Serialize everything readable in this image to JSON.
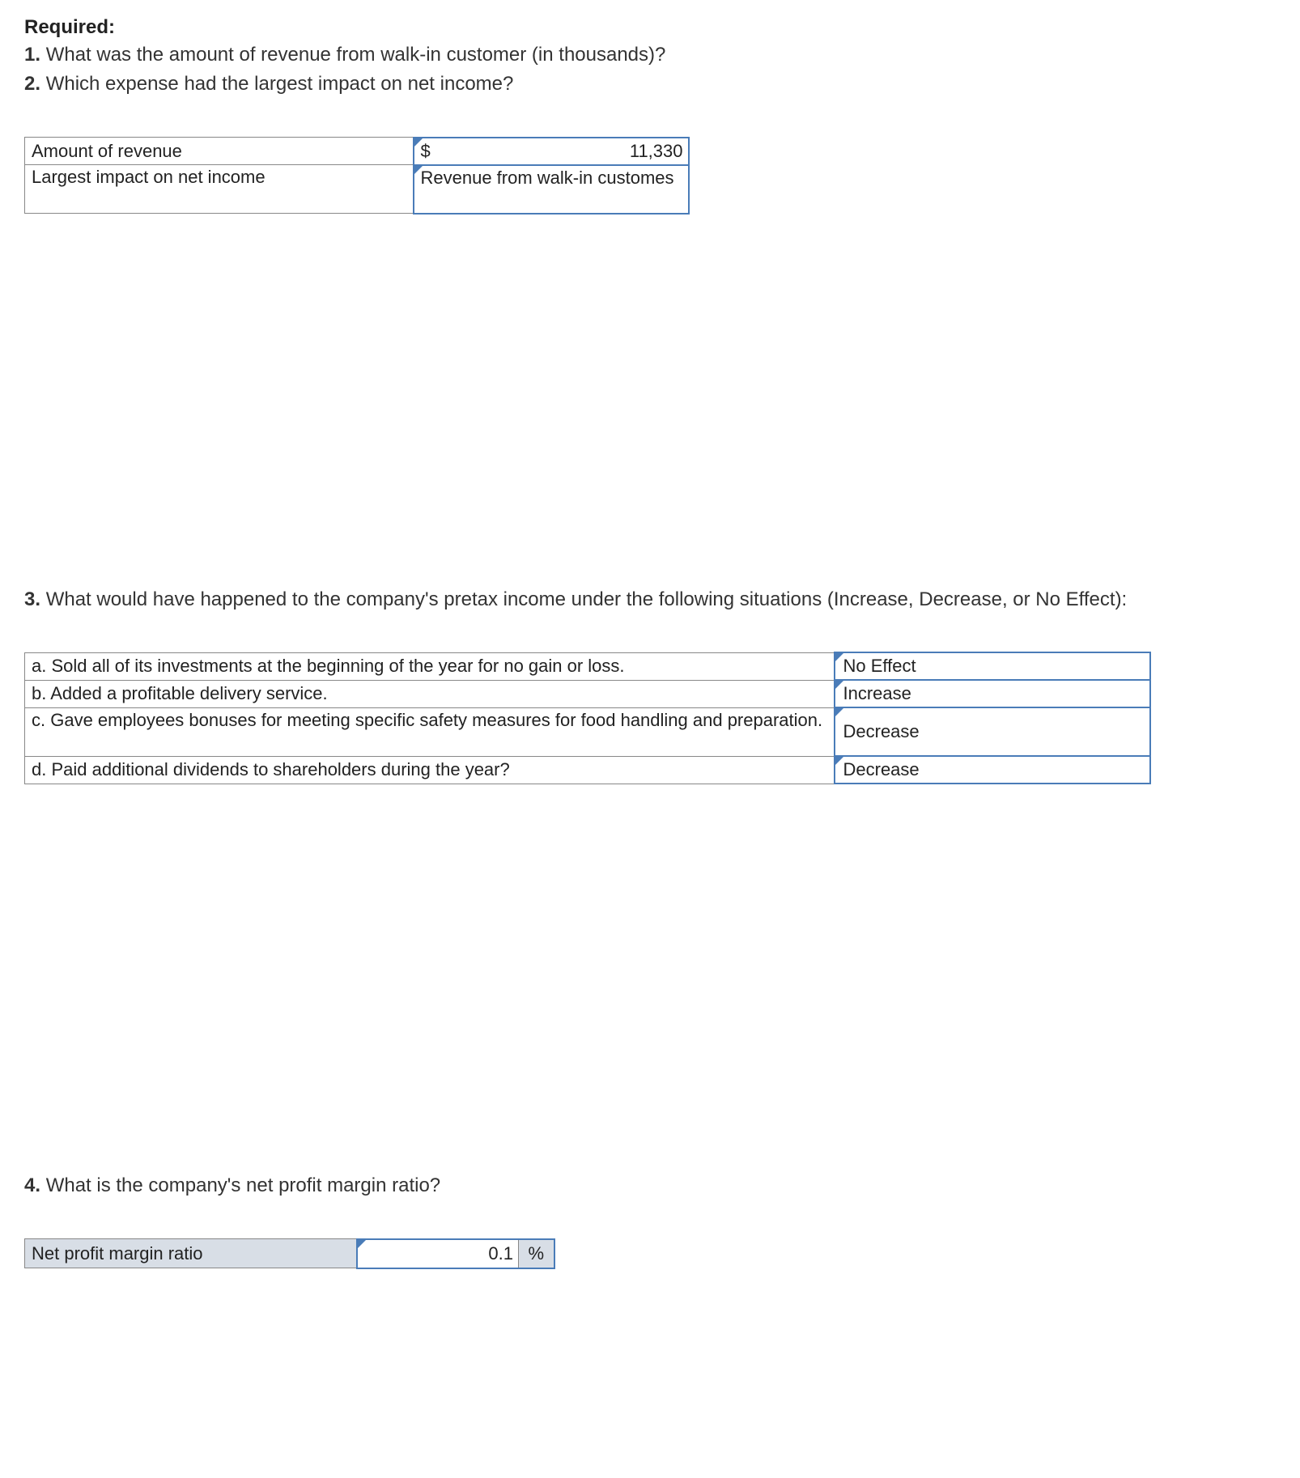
{
  "required_label": "Required:",
  "q1": {
    "num": "1.",
    "text": "What was the amount of revenue from walk-in customer (in thousands)?"
  },
  "q2": {
    "num": "2.",
    "text": "Which expense had the largest impact on net income?"
  },
  "table1": {
    "row1_label": "Amount of revenue",
    "row1_currency": "$",
    "row1_value": "11,330",
    "row2_label": "Largest impact on net income",
    "row2_value": "Revenue from walk-in customes"
  },
  "q3": {
    "num": "3.",
    "text": "What would have happened to the company's pretax income under the following situations (Increase, Decrease, or No Effect):"
  },
  "table2": {
    "a_label": "a. Sold all of its investments at the beginning of the year for no gain or loss.",
    "a_value": "No Effect",
    "b_label": "b. Added a profitable delivery service.",
    "b_value": "Increase",
    "c_label": "c. Gave employees bonuses for meeting specific safety measures for food handling and preparation.",
    "c_value": "Decrease",
    "d_label": "d. Paid additional dividends to shareholders during the year?",
    "d_value": "Decrease"
  },
  "q4": {
    "num": "4.",
    "text": "What is the company's net profit margin ratio?"
  },
  "table3": {
    "label": "Net profit margin ratio",
    "value": "0.1",
    "unit": "%"
  }
}
